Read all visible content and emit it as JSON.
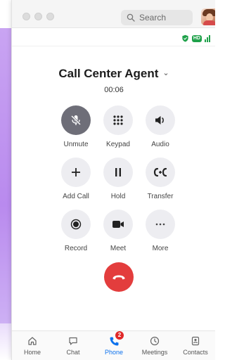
{
  "window": {
    "search_placeholder": "Search"
  },
  "status": {
    "hd_label": "HD",
    "accent_green": "#1fa14a"
  },
  "call": {
    "title": "Call Center Agent",
    "timer": "00:06"
  },
  "controls": {
    "unmute": "Unmute",
    "keypad": "Keypad",
    "audio": "Audio",
    "add_call": "Add Call",
    "hold": "Hold",
    "transfer": "Transfer",
    "record": "Record",
    "meet": "Meet",
    "more": "More"
  },
  "end_call_color": "#e33d3d",
  "nav": {
    "home": "Home",
    "chat": "Chat",
    "phone": "Phone",
    "phone_badge": "2",
    "meetings": "Meetings",
    "contacts": "Contacts",
    "active": "phone",
    "active_color": "#0e72ed"
  }
}
